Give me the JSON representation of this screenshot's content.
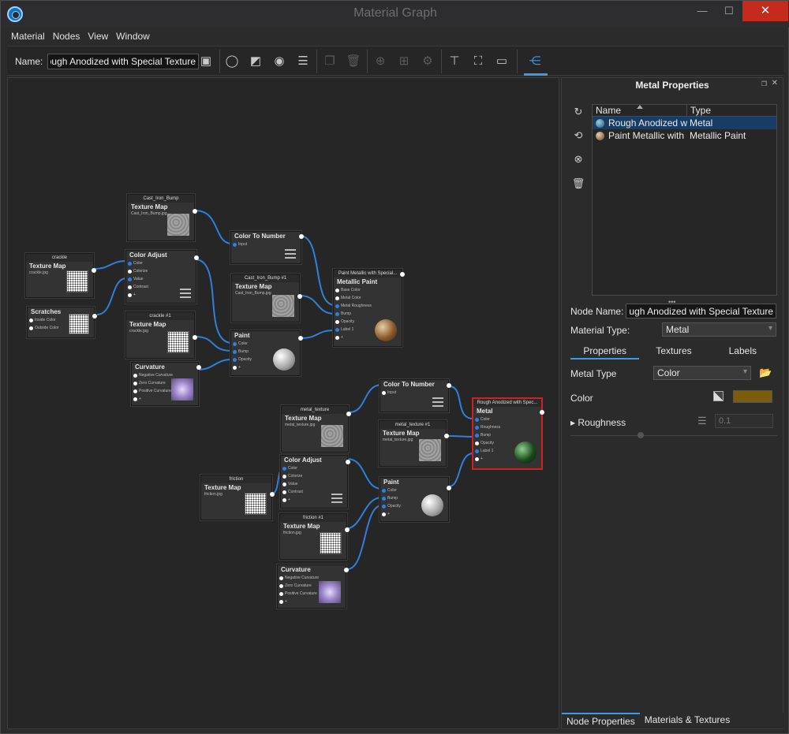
{
  "window": {
    "title": "Material Graph",
    "min_glyph": "—",
    "max_glyph": "☐",
    "close_glyph": "✕"
  },
  "menu": [
    "Material",
    "Nodes",
    "View",
    "Window"
  ],
  "toolbar": {
    "name_label": "Name:",
    "name_value": "Rough Anodized with Special Texture"
  },
  "panel": {
    "title": "Metal Properties",
    "list_headers": {
      "name": "Name",
      "type": "Type"
    },
    "materials": [
      {
        "name": "Rough Anodized with Special Texture",
        "type": "Metal"
      },
      {
        "name": "Paint Metallic with Special Texture",
        "type": "Metallic Paint"
      }
    ],
    "node_name_label": "Node Name:",
    "node_name_value": "Rough Anodized with Special Texture",
    "material_type_label": "Material Type:",
    "material_type_value": "Metal",
    "tabs": [
      "Properties",
      "Textures",
      "Labels"
    ],
    "metal_type_label": "Metal Type",
    "metal_type_value": "Color",
    "color_label": "Color",
    "roughness_label": "Roughness",
    "roughness_value": "0.1",
    "bottom_tabs": [
      "Node Properties",
      "Materials & Textures"
    ],
    "colors": {
      "metal_color": "#7a5c0c",
      "accent": "#3d9ae8"
    }
  },
  "nodes": {
    "cast_iron_bump": {
      "caption": "Cast_Iron_Bump",
      "title": "Texture Map",
      "file": "Cast_Iron_Bump.jpg"
    },
    "color_to_number_1": {
      "title": "Color To Number",
      "port": "Input"
    },
    "crackle": {
      "caption": "crackle",
      "title": "Texture Map",
      "file": "crackle.jpg"
    },
    "color_adjust_1": {
      "title": "Color Adjust",
      "ports": [
        "Color",
        "Colorize",
        "Value",
        "Contrast",
        "+"
      ]
    },
    "scratches": {
      "title": "Scratches",
      "ports": [
        "Inside Color",
        "Outside Color"
      ]
    },
    "cast_iron_bump_1": {
      "caption": "Cast_Iron_Bump #1",
      "title": "Texture Map",
      "file": "Cast_Iron_Bump.jpg"
    },
    "paint_metallic": {
      "caption": "Paint Metallic with Special...",
      "title": "Metallic Paint",
      "ports": [
        "Base Color",
        "Metal Color",
        "Metal Roughness",
        "Bump",
        "Opacity",
        "Label 1",
        "+"
      ]
    },
    "crackle_1": {
      "caption": "crackle #1",
      "title": "Texture Map",
      "file": "crackle.jpg"
    },
    "paint_1": {
      "title": "Paint",
      "ports": [
        "Color",
        "Bump",
        "Opacity",
        "+"
      ]
    },
    "curvature_1": {
      "title": "Curvature",
      "ports": [
        "Negative Curvature",
        "Zero Curvature",
        "Positive Curvature",
        "+"
      ]
    },
    "color_to_number_2": {
      "title": "Color To Number",
      "port": "Input"
    },
    "metal_texture": {
      "caption": "metal_texture",
      "title": "Texture Map",
      "file": "metal_texture.jpg"
    },
    "rough_anodized": {
      "caption": "Rough Anodized with Spec...",
      "title": "Metal",
      "ports": [
        "Color",
        "Roughness",
        "Bump",
        "Opacity",
        "Label 1",
        "+"
      ]
    },
    "metal_texture_1": {
      "caption": "metal_texture #1",
      "title": "Texture Map",
      "file": "metal_texture.jpg"
    },
    "friction": {
      "caption": "friction",
      "title": "Texture Map",
      "file": "friction.jpg"
    },
    "color_adjust_2": {
      "title": "Color Adjust",
      "ports": [
        "Color",
        "Colorize",
        "Value",
        "Contrast",
        "+"
      ]
    },
    "paint_2": {
      "title": "Paint",
      "ports": [
        "Color",
        "Bump",
        "Opacity",
        "+"
      ]
    },
    "friction_1": {
      "caption": "friction #1",
      "title": "Texture Map",
      "file": "friction.jpg"
    },
    "curvature_2": {
      "title": "Curvature",
      "ports": [
        "Negative Curvature",
        "Zero Curvature",
        "Positive Curvature",
        "+"
      ]
    }
  }
}
